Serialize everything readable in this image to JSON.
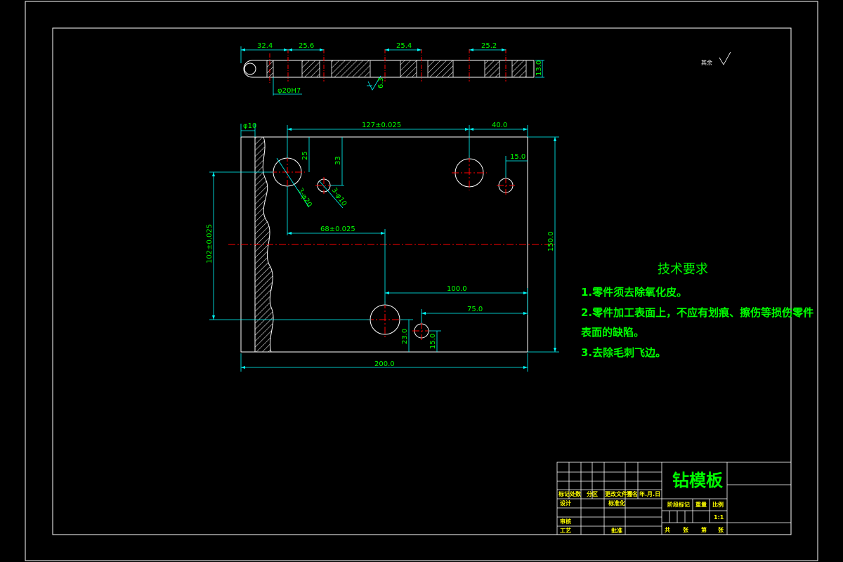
{
  "colors": {
    "background": "#000000",
    "outline": "#ffffff",
    "dimension": "#00ffff",
    "dimension_text": "#00ff00",
    "centerline": "#ff0000",
    "hatch": "#ffffff",
    "notes": "#00ff00",
    "title_block_text": "#ffff00"
  },
  "top_view": {
    "dims": [
      "32.4",
      "25.6",
      "25.4",
      "25.2",
      "13.0",
      "φ20H7"
    ],
    "roughness": "6.3"
  },
  "front_view": {
    "dims": {
      "phi10": "φ10",
      "d127": "127±0.025",
      "d40": "40.0",
      "d25": "25",
      "d33": "33",
      "d15a": "15.0",
      "hole20": "3-φ20",
      "hole10": "3-φ10",
      "d102": "102±0.025",
      "d68": "68±0.025",
      "d150": "150.0",
      "d100": "100.0",
      "d75": "75.0",
      "d23": "23.0",
      "d15b": "15.0",
      "d200": "200.0"
    }
  },
  "surface_note": {
    "label": "其余"
  },
  "technical_requirements": {
    "title": "技术要求",
    "lines": [
      "1.零件须去除氧化皮。",
      "2.零件加工表面上，不应有划痕、擦伤等损伤零件",
      "表面的缺陷。",
      "3.去除毛刺飞边。"
    ]
  },
  "title_block": {
    "part_name": "钻模板",
    "scale": "1:1",
    "headers": [
      "标记",
      "处数",
      "分区",
      "更改文件号",
      "签名",
      "年.月.日"
    ],
    "roles": [
      "设计",
      "标准化",
      "审核",
      "工艺",
      "批准"
    ],
    "stage_labels": [
      "阶段标记",
      "重量",
      "比例"
    ],
    "sheet_labels": [
      "共",
      "张",
      "第",
      "张"
    ]
  }
}
